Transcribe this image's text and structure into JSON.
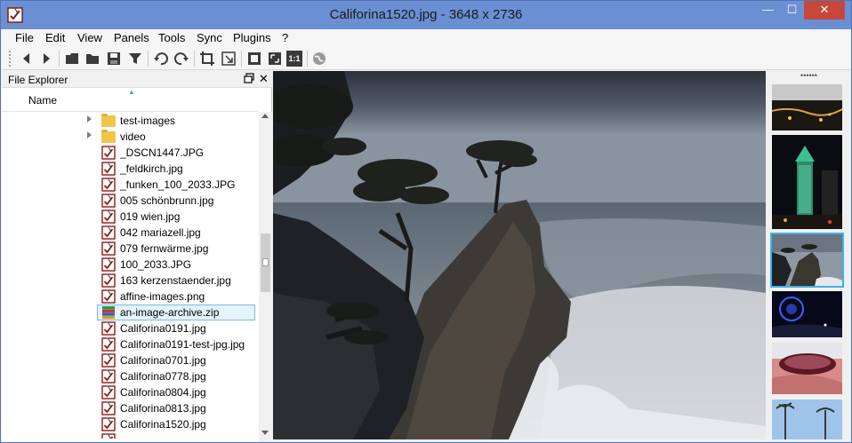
{
  "window": {
    "title": "Califorina1520.jpg  -  3648 x 2736",
    "min_glyph": "—",
    "max_glyph": "☐",
    "close_glyph": "✕"
  },
  "menu": [
    "File",
    "Edit",
    "View",
    "Panels",
    "Tools",
    "Sync",
    "Plugins",
    "?"
  ],
  "toolbar": {
    "buttons": [
      "back-icon",
      "forward-icon",
      "open-file-icon",
      "open-folder-icon",
      "save-icon",
      "filter-icon",
      "rotate-left-icon",
      "rotate-right-icon",
      "crop-icon",
      "resize-icon",
      "fit-window-icon",
      "fullscreen-icon",
      "actual-size-icon",
      "globe-icon"
    ],
    "actual_size_label": "1:1"
  },
  "file_explorer": {
    "title": "File Explorer",
    "float_glyph": "🗗",
    "close_glyph": "✕",
    "column_name": "Name",
    "sort_glyph": "▲",
    "items": [
      {
        "label": "test-images",
        "type": "folder"
      },
      {
        "label": "video",
        "type": "folder"
      },
      {
        "label": "_DSCN1447.JPG",
        "type": "image"
      },
      {
        "label": "_feldkirch.jpg",
        "type": "image"
      },
      {
        "label": "_funken_100_2033.JPG",
        "type": "image"
      },
      {
        "label": "005 schönbrunn.jpg",
        "type": "image"
      },
      {
        "label": "019 wien.jpg",
        "type": "image"
      },
      {
        "label": "042 mariazell.jpg",
        "type": "image"
      },
      {
        "label": "079 fernwärme.jpg",
        "type": "image"
      },
      {
        "label": "100_2033.JPG",
        "type": "image"
      },
      {
        "label": "163 kerzenstaender.jpg",
        "type": "image"
      },
      {
        "label": "affine-images.png",
        "type": "image"
      },
      {
        "label": "an-image-archive.zip",
        "type": "archive",
        "selected": true
      },
      {
        "label": "Califorina0191.jpg",
        "type": "image"
      },
      {
        "label": "Califorina0191-test-jpg.jpg",
        "type": "image"
      },
      {
        "label": "Califorina0701.jpg",
        "type": "image"
      },
      {
        "label": "Califorina0778.jpg",
        "type": "image"
      },
      {
        "label": "Califorina0804.jpg",
        "type": "image"
      },
      {
        "label": "Califorina0813.jpg",
        "type": "image"
      },
      {
        "label": "Califorina1520.jpg",
        "type": "image"
      },
      {
        "label": "",
        "type": "image"
      }
    ]
  },
  "thumbnails": {
    "grip": "••••••",
    "items": [
      {
        "name": "city-night-lights",
        "selected": false
      },
      {
        "name": "lit-tower-night",
        "selected": false
      },
      {
        "name": "cypress-coast",
        "selected": true
      },
      {
        "name": "blue-ferris-wheel",
        "selected": false
      },
      {
        "name": "sunglasses-closeup",
        "selected": false
      },
      {
        "name": "palm-trees-sky",
        "selected": false
      }
    ]
  },
  "colors": {
    "titlebar": "#6b8fd3",
    "close_button": "#c7483b",
    "selection_fill": "#e5f3fb",
    "selection_border": "#7ab8e4",
    "thumb_selected": "#3bb4e8"
  }
}
